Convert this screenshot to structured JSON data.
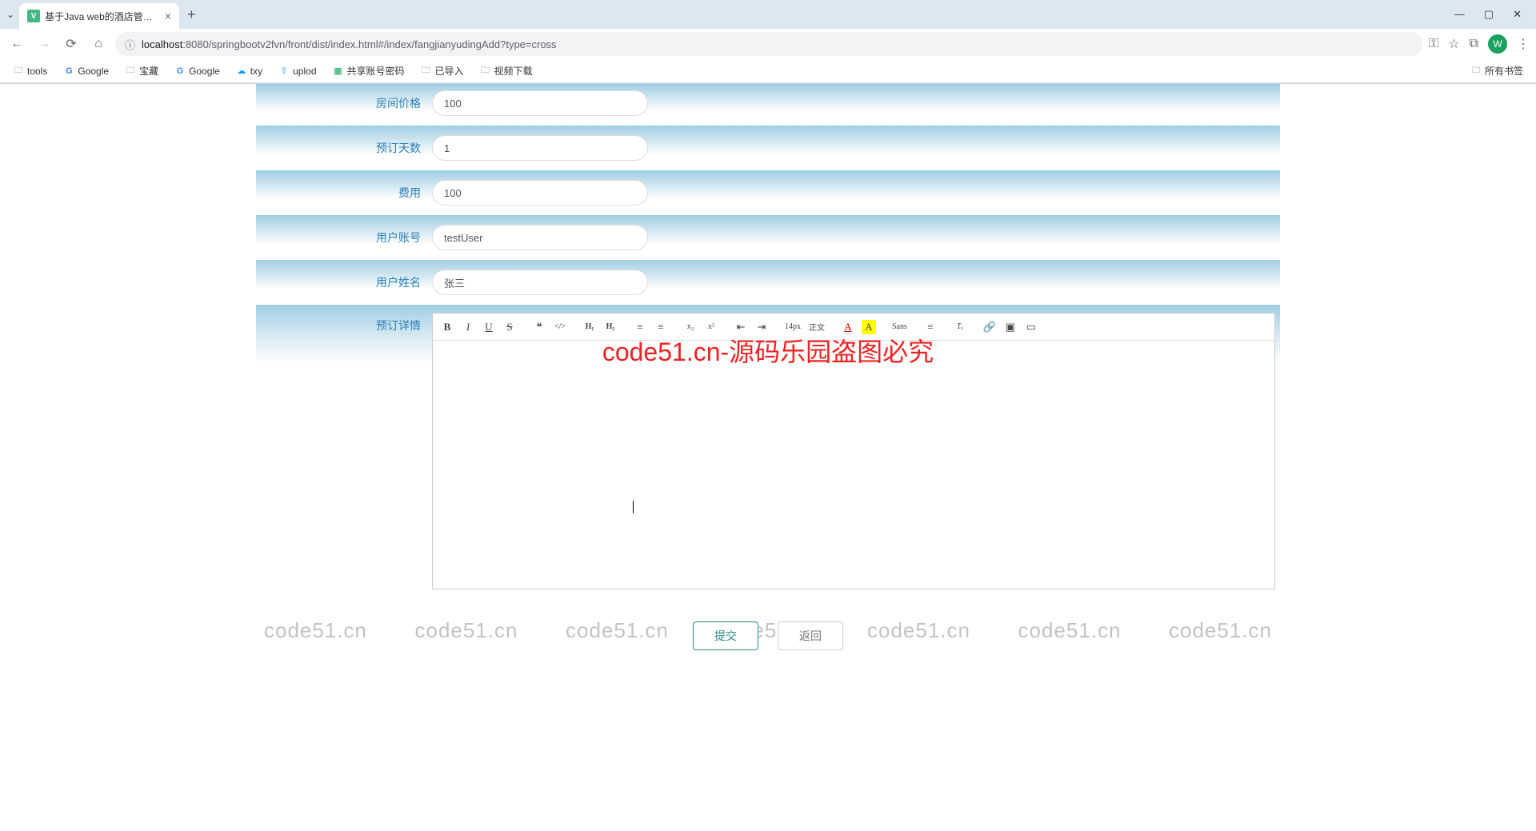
{
  "browser": {
    "tab_title": "基于Java web的酒店管理系统",
    "url_host": "localhost",
    "url_port": ":8080",
    "url_path": "/springbootv2fvn/front/dist/index.html#/index/fangjianyudingAdd?type=cross",
    "profile_letter": "W"
  },
  "bookmarks": [
    {
      "icon": "folder",
      "label": "tools"
    },
    {
      "icon": "google",
      "label": "Google"
    },
    {
      "icon": "folder",
      "label": "宝藏"
    },
    {
      "icon": "google",
      "label": "Google"
    },
    {
      "icon": "cloud",
      "label": "txy"
    },
    {
      "icon": "upload",
      "label": "uplod"
    },
    {
      "icon": "sheet",
      "label": "共享账号密码"
    },
    {
      "icon": "folder",
      "label": "已导入"
    },
    {
      "icon": "folder",
      "label": "视频下载"
    }
  ],
  "bookmarks_right": {
    "icon": "folder",
    "label": "所有书签"
  },
  "form": {
    "fields": {
      "room_price": {
        "label": "房间价格",
        "value": "100"
      },
      "booking_days": {
        "label": "预订天数",
        "value": "1"
      },
      "fee": {
        "label": "费用",
        "value": "100"
      },
      "user_account": {
        "label": "用户账号",
        "value": "testUser"
      },
      "user_name": {
        "label": "用户姓名",
        "value": "张三"
      },
      "booking_detail": {
        "label": "预订详情"
      }
    },
    "submit_label": "提交",
    "back_label": "返回"
  },
  "editor_buttons": {
    "bold": "B",
    "italic": "I",
    "underline": "U",
    "strike": "S",
    "quote": "❝",
    "code": "</>",
    "h1": "H₁",
    "h2": "H₂",
    "ol": "≡",
    "ul": "≡",
    "sub": "x₂",
    "sup": "x²",
    "indent_dec": "⇤",
    "indent_inc": "⇥",
    "size": "14px",
    "header": "正文",
    "color": "A",
    "bg": "A",
    "font": "Sans",
    "align": "≡",
    "clean": "Tₓ",
    "link": "🔗",
    "image": "▣",
    "video": "▭"
  },
  "watermark_text": "code51.cn",
  "red_banner": "code51.cn-源码乐园盗图必究"
}
